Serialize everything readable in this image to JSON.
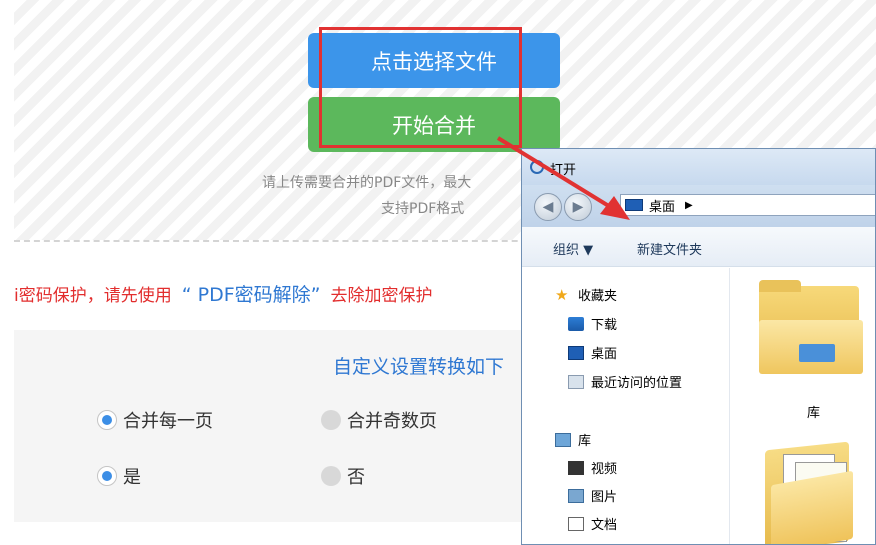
{
  "upload": {
    "select_button": "点击选择文件",
    "merge_button": "开始合并",
    "hint_line1": "请上传需要合并的PDF文件，最大",
    "hint_line2": "支持PDF格式"
  },
  "warning": {
    "prefix": "i密码保护，请先使用",
    "link": "“ PDF密码解除”",
    "suffix": "去除加密保护"
  },
  "settings": {
    "title": "自定义设置转换如下",
    "options": [
      {
        "label": "合并每一页",
        "checked": true
      },
      {
        "label": "合并奇数页",
        "checked": false
      },
      {
        "label": "是",
        "checked": true
      },
      {
        "label": "否",
        "checked": false
      }
    ]
  },
  "dialog": {
    "title": "打开",
    "address": "桌面",
    "toolbar": {
      "organize": "组织 ▼",
      "new_folder": "新建文件夹"
    },
    "nav": {
      "favorites": "收藏夹",
      "downloads": "下载",
      "desktop": "桌面",
      "recent": "最近访问的位置",
      "libraries": "库",
      "videos": "视频",
      "pictures": "图片",
      "documents": "文档"
    },
    "content_label": "库"
  },
  "colors": {
    "select_button": "#3c95ea",
    "merge_button": "#5cb85c",
    "highlight": "#e13232",
    "link": "#2f78d2",
    "warning": "#e22d2d"
  }
}
